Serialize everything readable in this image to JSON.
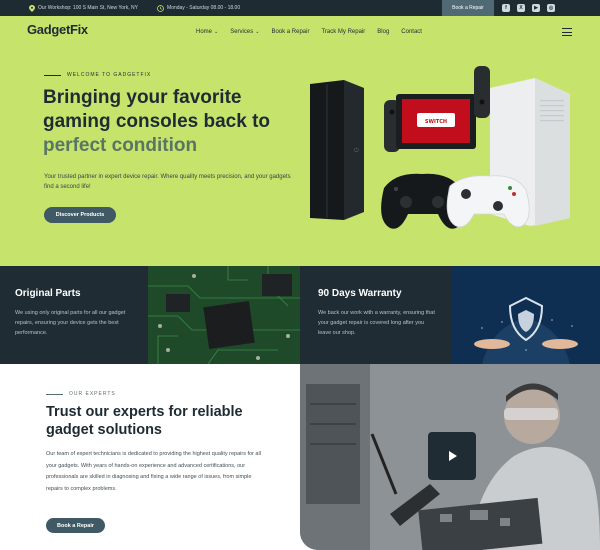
{
  "topbar": {
    "workshop": "Our Workshop: 100 S Main St, New York, NY",
    "hours": "Monday - Saturday 08.00 - 18.00",
    "cta": "Book a Repair",
    "icons": [
      "location-pin-icon",
      "clock-icon"
    ],
    "socials": [
      {
        "name": "facebook-icon",
        "glyph": "f"
      },
      {
        "name": "x-icon",
        "glyph": "X"
      },
      {
        "name": "youtube-icon",
        "glyph": "▶"
      },
      {
        "name": "instagram-icon",
        "glyph": "◎"
      }
    ]
  },
  "nav": {
    "logo": "GadgetFix",
    "items": [
      {
        "label": "Home",
        "dropdown": true
      },
      {
        "label": "Services",
        "dropdown": true
      },
      {
        "label": "Book a Repair",
        "dropdown": false
      },
      {
        "label": "Track My Repair",
        "dropdown": false
      },
      {
        "label": "Blog",
        "dropdown": false
      },
      {
        "label": "Contact",
        "dropdown": false
      }
    ]
  },
  "hero": {
    "eyebrow": "WELCOME TO GADGETFIX",
    "title_line1": "Bringing your favorite",
    "title_line2": "gaming consoles back to",
    "title_line3": "perfect condition",
    "description": "Your trusted partner in expert device repair. Where quality meets precision, and your gadgets find a second life!",
    "button": "Discover Products"
  },
  "features": [
    {
      "title": "Original Parts",
      "text": "We using only original parts for all our gadget repairs, ensuring your device gets the best performance."
    },
    {
      "title": "90 Days Warranty",
      "text": "We back our work with a warranty, ensuring that your gadget repair is covered long after you leave our shop."
    }
  ],
  "experts": {
    "eyebrow": "OUR EXPERTS",
    "title": "Trust our experts for reliable gadget solutions",
    "text": "Our team of expert technicians is dedicated to providing the highest quality repairs for all your gadgets. With years of hands-on experience and advanced certifications, our professionals are skilled in diagnosing and fixing a wide range of issues, from simple repairs to complex problems.",
    "button": "Book a Repair"
  },
  "colors": {
    "accent": "#c6e46c",
    "dark": "#1e2b33",
    "button": "#3f5a64"
  }
}
